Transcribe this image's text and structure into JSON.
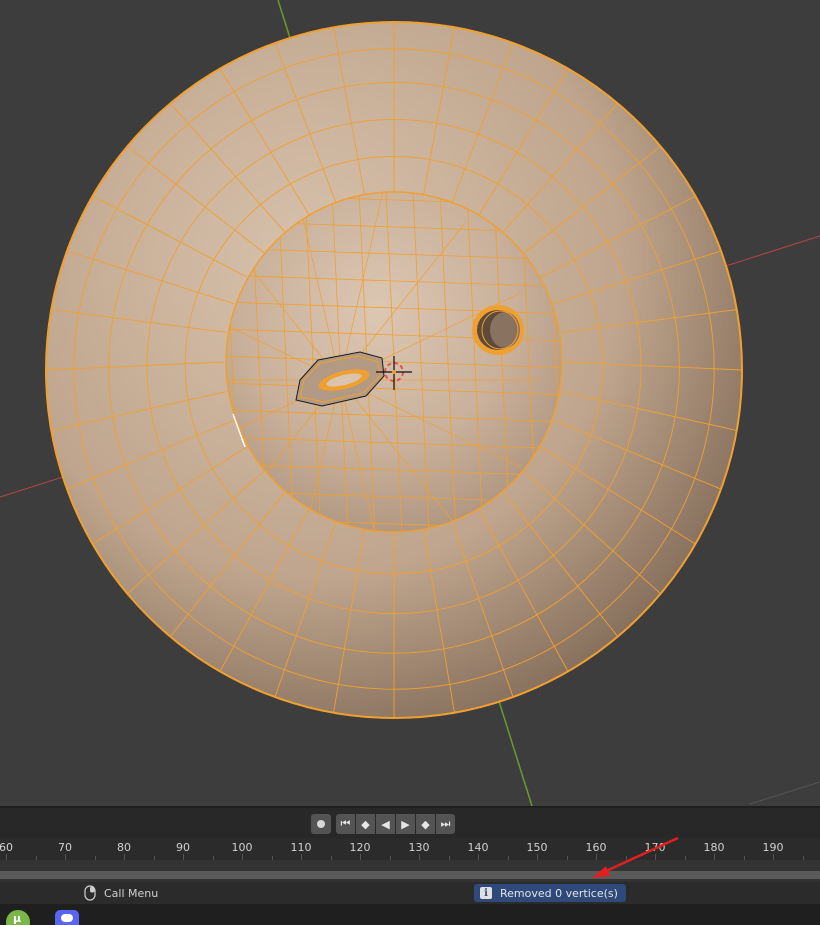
{
  "viewport": {
    "axis_colors": {
      "x": "#c0464b",
      "y": "#6b9a2a"
    },
    "wire_color": "#f0a030",
    "mesh_fill": "#c8b09a"
  },
  "playback": {
    "record_icon": "record-icon",
    "buttons": [
      {
        "name": "jump-start-button",
        "glyph": "⏮"
      },
      {
        "name": "prev-keyframe-button",
        "glyph": "◆"
      },
      {
        "name": "play-reverse-button",
        "glyph": "◀"
      },
      {
        "name": "play-button",
        "glyph": "▶"
      },
      {
        "name": "next-keyframe-button",
        "glyph": "◆"
      },
      {
        "name": "jump-end-button",
        "glyph": "⏭"
      }
    ]
  },
  "frame_ruler": {
    "labels": [
      "60",
      "70",
      "80",
      "90",
      "100",
      "110",
      "120",
      "130",
      "140",
      "150",
      "160",
      "170",
      "180",
      "190"
    ]
  },
  "status": {
    "call_menu": "Call Menu",
    "report": "Removed 0 vertice(s)"
  },
  "annotation": {
    "arrow_color": "#e02020"
  },
  "taskbar": {
    "icons": [
      "utorrent-icon",
      "discord-icon"
    ]
  }
}
